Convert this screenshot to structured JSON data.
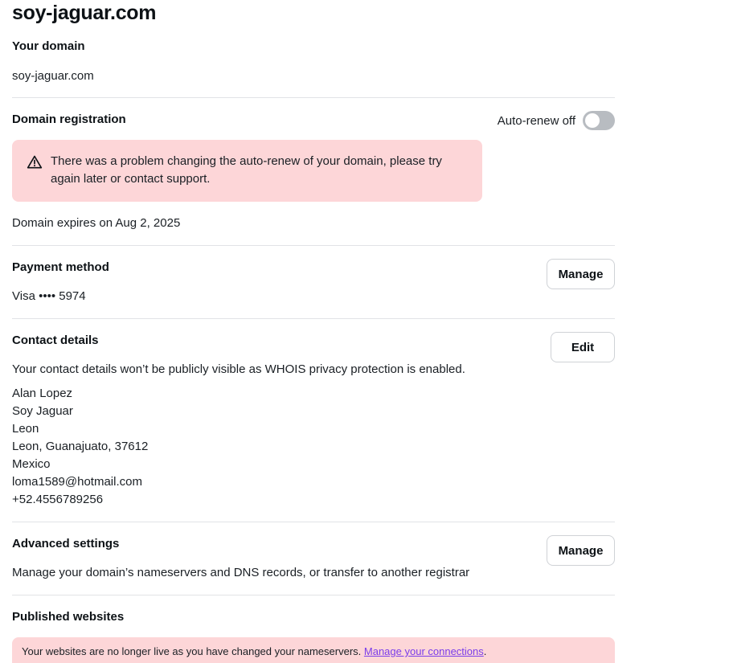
{
  "page": {
    "title": "soy-jaguar.com"
  },
  "your_domain": {
    "heading": "Your domain",
    "value": "soy-jaguar.com"
  },
  "registration": {
    "heading": "Domain registration",
    "auto_renew_label": "Auto-renew off",
    "auto_renew_on": false,
    "error_message": "There was a problem changing the auto-renew of your domain, please try again later or contact support.",
    "expiry_text": "Domain expires on Aug 2, 2025"
  },
  "payment": {
    "heading": "Payment method",
    "card": "Visa •••• 5974",
    "button_label": "Manage"
  },
  "contact": {
    "heading": "Contact details",
    "button_label": "Edit",
    "privacy_note": "Your contact details won’t be publicly visible as WHOIS privacy protection is enabled.",
    "lines": [
      "Alan Lopez",
      "Soy Jaguar",
      "Leon",
      "Leon, Guanajuato, 37612",
      "Mexico",
      "loma1589@hotmail.com",
      "+52.4556789256"
    ]
  },
  "advanced": {
    "heading": "Advanced settings",
    "description": "Manage your domain’s nameservers and DNS records, or transfer to another registrar",
    "button_label": "Manage"
  },
  "published": {
    "heading": "Published websites",
    "banner_text": "Your websites are no longer live as you have changed your nameservers. ",
    "banner_link": "Manage your connections",
    "banner_suffix": "."
  },
  "colors": {
    "alert_bg": "#fdd6d8",
    "link": "#7a3dea",
    "toggle_off": "#b8bcc1"
  },
  "icons": {
    "alert": "warning-triangle-icon"
  }
}
